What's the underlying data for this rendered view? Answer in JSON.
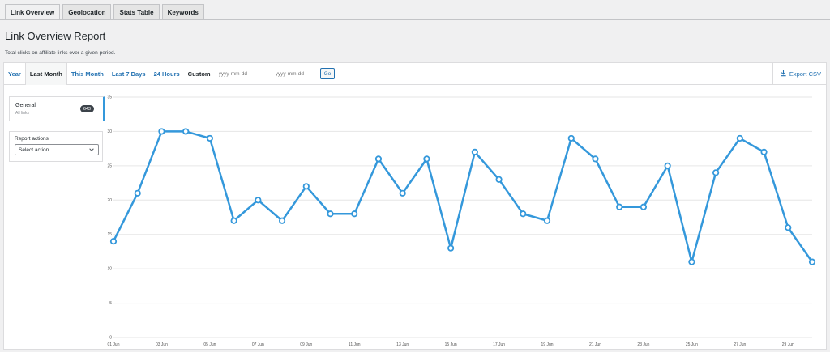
{
  "tabs": [
    {
      "label": "Link Overview",
      "active": true
    },
    {
      "label": "Geolocation",
      "active": false
    },
    {
      "label": "Stats Table",
      "active": false
    },
    {
      "label": "Keywords",
      "active": false
    }
  ],
  "page": {
    "title": "Link Overview Report",
    "subtitle": "Total clicks on affiliate links over a given period."
  },
  "toolbar": {
    "ranges": [
      "Year",
      "Last Month",
      "This Month",
      "Last 7 Days",
      "24 Hours"
    ],
    "current_range": "Last Month",
    "custom_label": "Custom",
    "start_placeholder": "yyyy-mm-dd",
    "separator": "—",
    "end_placeholder": "yyyy-mm-dd",
    "go_label": "Go",
    "export_label": "Export CSV",
    "export_icon": "download-icon"
  },
  "sidebar": {
    "legend": {
      "title": "General",
      "subtitle": "All links",
      "count": "643",
      "color": "#3498db"
    },
    "report_actions": {
      "label": "Report actions",
      "selected": "Select action"
    }
  },
  "chart_data": {
    "type": "line",
    "x": [
      "01 Jun",
      "02 Jun",
      "03 Jun",
      "04 Jun",
      "05 Jun",
      "06 Jun",
      "07 Jun",
      "08 Jun",
      "09 Jun",
      "10 Jun",
      "11 Jun",
      "12 Jun",
      "13 Jun",
      "14 Jun",
      "15 Jun",
      "16 Jun",
      "17 Jun",
      "18 Jun",
      "19 Jun",
      "20 Jun",
      "21 Jun",
      "22 Jun",
      "23 Jun",
      "24 Jun",
      "25 Jun",
      "26 Jun",
      "27 Jun",
      "28 Jun",
      "29 Jun",
      "30 Jun"
    ],
    "x_tick_labels": [
      "01 Jun",
      "03 Jun",
      "05 Jun",
      "07 Jun",
      "09 Jun",
      "11 Jun",
      "13 Jun",
      "15 Jun",
      "17 Jun",
      "19 Jun",
      "21 Jun",
      "23 Jun",
      "25 Jun",
      "27 Jun",
      "29 Jun"
    ],
    "series": [
      {
        "name": "General",
        "color": "#3498db",
        "values": [
          14,
          21,
          30,
          30,
          29,
          17,
          20,
          17,
          22,
          18,
          18,
          26,
          21,
          26,
          13,
          27,
          23,
          18,
          17,
          29,
          26,
          19,
          19,
          25,
          11,
          24,
          29,
          27,
          16,
          11
        ]
      }
    ],
    "ylim": [
      0,
      35
    ],
    "y_ticks": [
      0,
      5,
      10,
      15,
      20,
      25,
      30,
      35
    ],
    "grid": true
  }
}
